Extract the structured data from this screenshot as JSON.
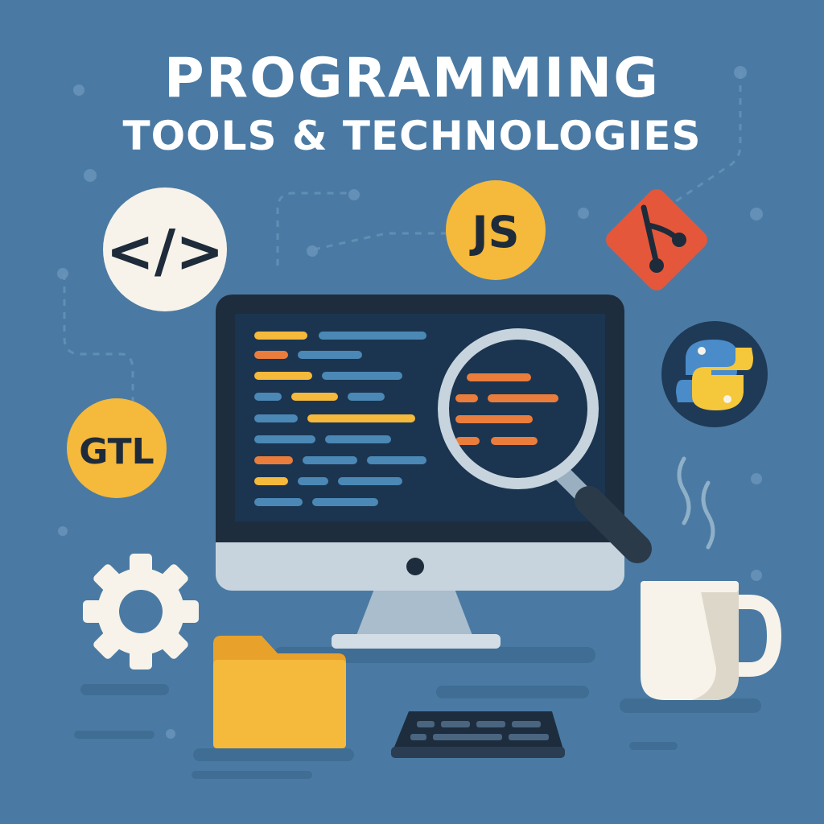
{
  "header": {
    "title": "PROGRAMMING",
    "subtitle": "TOOLS & TECHNOLOGIES"
  },
  "badges": {
    "code": "</>",
    "js": "JS",
    "gtl": "GTL"
  },
  "icons": [
    "code-brackets-icon",
    "javascript-icon",
    "git-icon",
    "python-icon",
    "gtl-icon",
    "gear-icon",
    "folder-icon",
    "keyboard-icon",
    "coffee-mug-icon",
    "magnifying-glass-icon",
    "monitor-icon"
  ],
  "colors": {
    "background": "#4a7aa3",
    "yellow": "#f5b93b",
    "orange": "#ea7d3c",
    "code_blue": "#4b88b5",
    "screen": "#1b3550",
    "git_red": "#e5573b",
    "cream": "#f7f3ea"
  }
}
